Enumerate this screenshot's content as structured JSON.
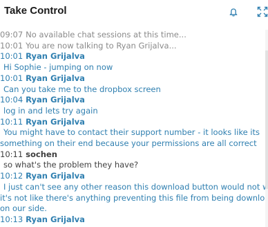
{
  "window": {
    "title": "Take Control"
  },
  "icons": {
    "notifications": "bell-icon",
    "expand": "expand-icon"
  },
  "chat": {
    "lines": [
      {
        "kind": "system",
        "time": "09:07",
        "text": "No available chat sessions at this time..."
      },
      {
        "kind": "system",
        "time": "10:01",
        "text": "You are now talking to Ryan Grijalva..."
      },
      {
        "kind": "header",
        "time": "10:01",
        "who": "Ryan Grijalva",
        "local": false
      },
      {
        "kind": "msg",
        "text": "Hi Sophie - jumping on now",
        "local": false
      },
      {
        "kind": "header",
        "time": "10:01",
        "who": "Ryan Grijalva",
        "local": false
      },
      {
        "kind": "msg",
        "text": "Can you take me to the dropbox screen",
        "local": false
      },
      {
        "kind": "header",
        "time": "10:04",
        "who": "Ryan Grijalva",
        "local": false
      },
      {
        "kind": "msg",
        "text": "log in and lets try again",
        "local": false
      },
      {
        "kind": "header",
        "time": "10:11",
        "who": "Ryan Grijalva",
        "local": false
      },
      {
        "kind": "msg",
        "text": "You might have to contact their support number - it looks like its",
        "local": false
      },
      {
        "kind": "msg",
        "text": "something on their end because your permissions are all correct",
        "local": false,
        "indent": false
      },
      {
        "kind": "header",
        "time": "10:11",
        "who": "sochen",
        "local": true
      },
      {
        "kind": "msg",
        "text": "so what's the problem they have?",
        "local": true
      },
      {
        "kind": "header",
        "time": "10:12",
        "who": "Ryan Grijalva",
        "local": false
      },
      {
        "kind": "msg",
        "text": "I just can't see any other reason this download button would not work -",
        "local": false
      },
      {
        "kind": "msg",
        "text": "it's not like there's anything preventing this file from being downloaded",
        "local": false,
        "indent": false
      },
      {
        "kind": "msg",
        "text": "on our side.",
        "local": false,
        "indent": false
      },
      {
        "kind": "header",
        "time": "10:13",
        "who": "Ryan Grijalva",
        "local": false
      }
    ]
  },
  "colors": {
    "accent": "#2f7fb0",
    "system_text": "#8a8a8a",
    "local_text": "#404040"
  }
}
